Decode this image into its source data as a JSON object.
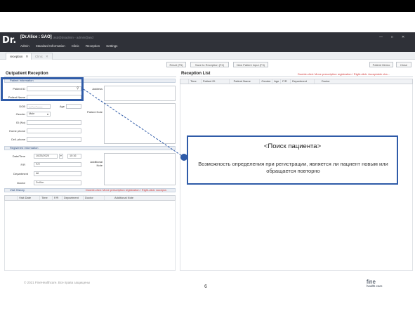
{
  "app": {
    "logo_text": "Dr.",
    "title": "[Dr.Alice : SAO]",
    "title_sub": "asd@dsadmin - admin@asd",
    "menu": [
      "Admin",
      "Standard Information",
      "Clinic",
      "Reception",
      "Settings"
    ],
    "window_controls": [
      "—",
      "□",
      "✕"
    ]
  },
  "tabs": [
    {
      "label": "reception",
      "close": "✕",
      "active": true
    },
    {
      "label": "Clinic",
      "close": "✕",
      "active": false
    }
  ],
  "toolbar": {
    "reset": "Reset (F5)",
    "save_to_reception": "Save to Reception (F2)",
    "new_patient_input": "New Patient Input (F3)",
    "patient_memo": "Patient Memo",
    "close": "Close"
  },
  "outpatient": {
    "title": "Outpatient Reception",
    "patient_info_header": "Patient Information",
    "labels": {
      "patient_id": "Patient ID",
      "patient_name": "Patient Name",
      "dob": "DOB",
      "age": "Age",
      "gender": "Gender",
      "id_no": "ID (No)",
      "home_phone": "Home phone",
      "cell_phone": "Cell. phone",
      "address": "Address",
      "patient_note": "Patient Note"
    },
    "dob_placeholder": "__-__-____",
    "gender_value": "Male",
    "registered_header": "Registered Information",
    "reg_labels": {
      "date_time": "Date/Time",
      "fr": "F/R",
      "department": "Department",
      "doctor": "Doctor",
      "additional_note": "Additional Note"
    },
    "reg_values": {
      "date": "10/25/2020",
      "time": "10:16",
      "fr": "F/V",
      "department": "All",
      "doctor": "Dr.Kim"
    },
    "visit_history_header": "Visit History",
    "visit_history_note": "Double-click: Move prescription registration / Right-click: Accepta",
    "visit_columns": [
      "Visit Date",
      "Time",
      "F/R",
      "Department",
      "Doctor",
      "Additional Note"
    ]
  },
  "reception_list": {
    "title": "Reception List",
    "note": "Double-click: Move prescription registration / Right-click: Acceptable cha...",
    "columns": [
      "Time",
      "Patient ID",
      "Patient Name",
      "Gender",
      "Age",
      "F/R",
      "Department",
      "Doctor"
    ]
  },
  "callout": {
    "title": "<Поиск пациента>",
    "body": "Возможность определения при регистрации, является ли пациент новым или обращается повторно"
  },
  "footer": {
    "copyright": "© 2021 FineHealthcare. Все права защищены",
    "page_number": "6",
    "brand_line1": "fine",
    "brand_line2": "health-care"
  },
  "colors": {
    "accent": "#2f5ba8",
    "titlebar": "#2f3138",
    "note_red": "#d23a3a"
  }
}
